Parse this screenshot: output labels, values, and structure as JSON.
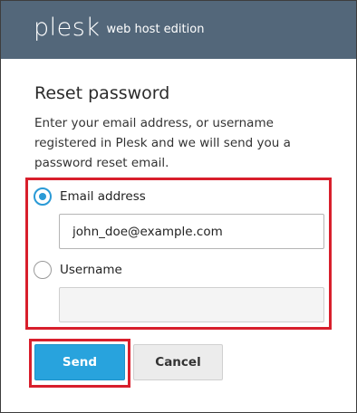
{
  "header": {
    "brand": "plesk",
    "edition": "web host edition"
  },
  "form": {
    "title": "Reset password",
    "description": "Enter your email address, or username registered in Plesk and we will send you a password reset email.",
    "options": [
      {
        "label": "Email address",
        "checked": true,
        "value": "john_doe@example.com",
        "placeholder": ""
      },
      {
        "label": "Username",
        "checked": false,
        "value": "",
        "placeholder": ""
      }
    ]
  },
  "buttons": {
    "send": "Send",
    "cancel": "Cancel"
  },
  "colors": {
    "header_bg": "#53677a",
    "accent": "#28a3dd",
    "highlight": "#d81f2c"
  }
}
